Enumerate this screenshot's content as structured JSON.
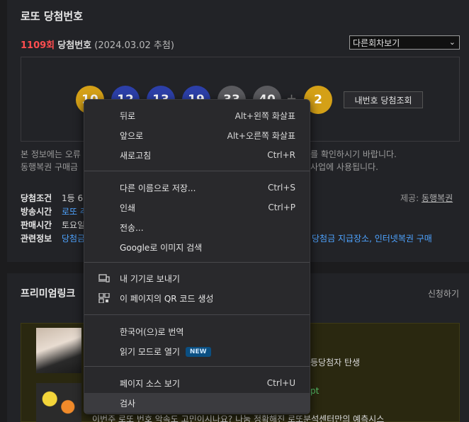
{
  "lotto": {
    "section_title": "로또 당첨번호",
    "round": "1109회",
    "round_label": "당첨번호",
    "draw_date": "(2024.03.02 추첨)",
    "other_rounds": "다른회차보기",
    "balls": [
      {
        "num": "10",
        "color": "#d4a017"
      },
      {
        "num": "12",
        "color": "#2c3fa8"
      },
      {
        "num": "13",
        "color": "#2c3fa8"
      },
      {
        "num": "19",
        "color": "#2c3fa8"
      },
      {
        "num": "33",
        "color": "#5a5a5e"
      },
      {
        "num": "40",
        "color": "#5a5a5e"
      }
    ],
    "plus": "+",
    "bonus": {
      "num": "2",
      "color": "#d4a017"
    },
    "my_number_button": "내번호 당첨조회",
    "notice_line1": "본 정보에는 오류",
    "notice_line2": "동행복권 구매금",
    "notice_right1": "를 확인하시기 바랍니다.",
    "notice_right2": "사업에 사용됩니다.",
    "info": [
      {
        "label": "당첨조건",
        "value": "1등 6"
      },
      {
        "label": "방송시간",
        "value": "로또 추",
        "is_link": true
      },
      {
        "label": "판매시간",
        "value": "토요일"
      },
      {
        "label": "관련정보",
        "value": "당첨금",
        "is_link": true
      }
    ],
    "provider_label": "제공:",
    "provider_name": "동행복권",
    "related_links": "당첨금 지급장소, 인터넷복권 구매"
  },
  "premium": {
    "title": "프리미엄링크",
    "apply": "신청하기",
    "promo_text1": "등당첨자 탄생",
    "promo_text2": "pt",
    "promo_text3": "이번주 로또 번호 악속도 고민이시나요? 나눔 정확해진 로또분석센터만의 예측시스"
  },
  "context_menu": {
    "items": [
      {
        "label": "뒤로",
        "shortcut": "Alt+왼쪽 화살표"
      },
      {
        "label": "앞으로",
        "shortcut": "Alt+오른쪽 화살표"
      },
      {
        "label": "새로고침",
        "shortcut": "Ctrl+R"
      },
      {
        "label": "다른 이름으로 저장...",
        "shortcut": "Ctrl+S"
      },
      {
        "label": "인쇄",
        "shortcut": "Ctrl+P"
      },
      {
        "label": "전송...",
        "shortcut": ""
      },
      {
        "label": "Google로 이미지 검색",
        "shortcut": ""
      },
      {
        "label": "내 기기로 보내기",
        "shortcut": "",
        "icon": "devices-icon"
      },
      {
        "label": "이 페이지의 QR 코드 생성",
        "shortcut": "",
        "icon": "qr-code-icon"
      },
      {
        "label": "한국어(으)로 번역",
        "shortcut": ""
      },
      {
        "label": "읽기 모드로 열기",
        "shortcut": "",
        "badge": "NEW"
      },
      {
        "label": "페이지 소스 보기",
        "shortcut": "Ctrl+U"
      },
      {
        "label": "검사",
        "shortcut": ""
      }
    ]
  }
}
